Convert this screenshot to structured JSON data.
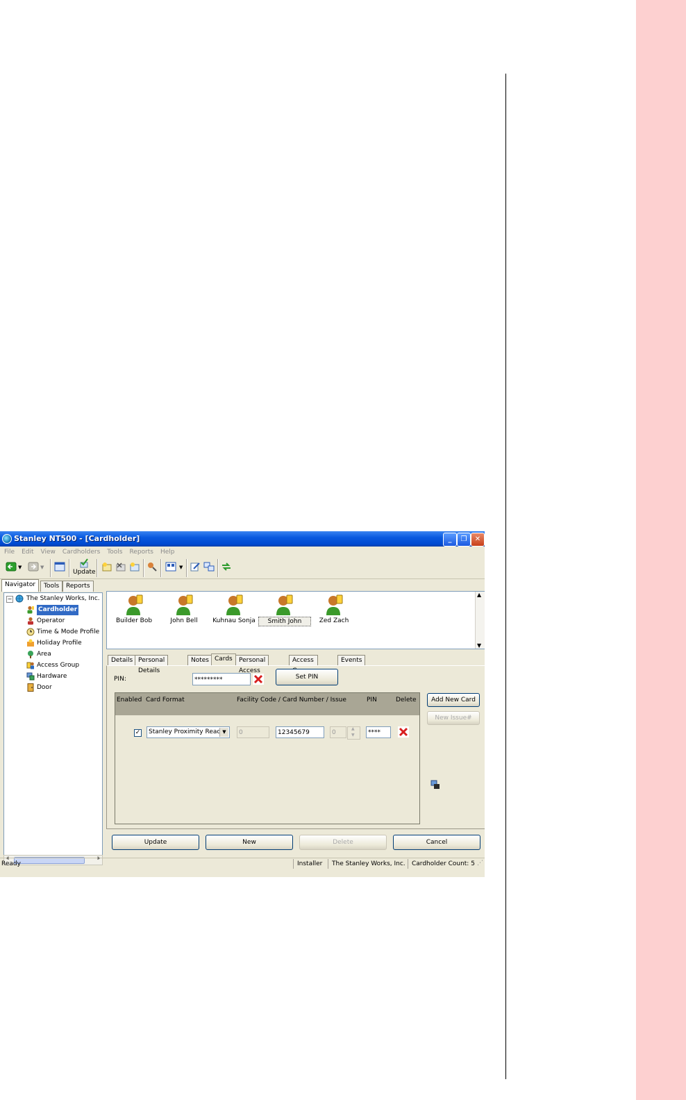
{
  "window": {
    "title": "Stanley NT500 - [Cardholder]"
  },
  "menu": [
    "File",
    "Edit",
    "View",
    "Cardholders",
    "Tools",
    "Reports",
    "Help"
  ],
  "toolbar": {
    "update_label": "Update"
  },
  "left_tabs": [
    "Navigator",
    "Tools",
    "Reports"
  ],
  "tree": {
    "root": "The Stanley Works, Inc.",
    "items": [
      "Cardholder",
      "Operator",
      "Time & Mode Profile",
      "Holiday Profile",
      "Area",
      "Access Group",
      "Hardware",
      "Door"
    ]
  },
  "cardholders": [
    "Builder Bob",
    "John Bell",
    "Kuhnau Sonja",
    "Smith John",
    "Zed Zach"
  ],
  "detail_tabs": [
    "Details",
    "Personal Details",
    "Notes",
    "Cards",
    "Personal Access",
    "Access Groups",
    "Events"
  ],
  "pin": {
    "label": "PIN:",
    "value": "*********",
    "set_button": "Set PIN"
  },
  "grid": {
    "headers": [
      "Enabled",
      "Card Format",
      "Facility Code / Card Number / Issue",
      "PIN",
      "Delete"
    ],
    "row": {
      "enabled_mark": "✓",
      "card_format": "Stanley Proximity Reade",
      "facility_code": "0",
      "card_number": "12345679",
      "issue": "0",
      "pin": "****"
    }
  },
  "side_buttons": {
    "add_new_card": "Add New Card",
    "new_issue": "New Issue#"
  },
  "bottom_buttons": {
    "update": "Update",
    "new": "New",
    "delete": "Delete",
    "cancel": "Cancel"
  },
  "status": {
    "ready": "Ready",
    "user": "Installer",
    "company": "The Stanley Works, Inc.",
    "count": "Cardholder Count: 5"
  },
  "colors": {
    "titlebar": "#0a5ae0",
    "page_accent": "#fdd0d0",
    "window_bg": "#ece9d8"
  }
}
